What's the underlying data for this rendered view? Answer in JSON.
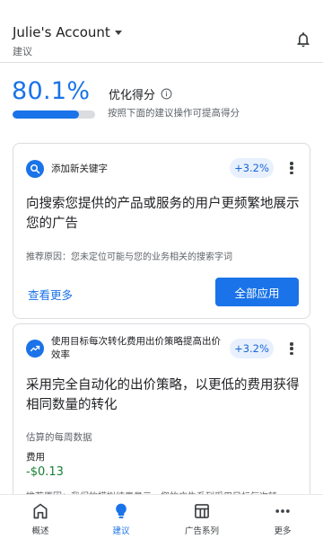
{
  "header": {
    "account_name": "Julie's Account",
    "section_title": "建议"
  },
  "score": {
    "value": "80.1%",
    "fraction": 0.801,
    "label": "优化得分",
    "description": "按照下面的建议操作可提高得分"
  },
  "cards": [
    {
      "title": "添加新关键字",
      "uplift": "+3.2%",
      "headline": "向搜索您提供的产品或服务的用户更频繁地展示您的广告",
      "reason": "推荐原因：您未定位可能与您的业务相关的搜索字词",
      "see_more": "查看更多",
      "apply_all": "全部应用"
    },
    {
      "title": "使用目标每次转化费用出价策略提高出价效率",
      "uplift": "+3.2%",
      "headline": "采用完全自动化的出价策略，以更低的费用获得相同数量的转化",
      "estimate_label": "估算的每周数据",
      "cost_label": "费用",
      "cost_value": "-$0.13",
      "reason_partial": "推荐原因：我们的模拟结果显示，您的广告系列采用目标每次转"
    }
  ],
  "nav": [
    {
      "label": "概述",
      "icon": "home-icon"
    },
    {
      "label": "建议",
      "icon": "lightbulb-icon"
    },
    {
      "label": "广告系列",
      "icon": "campaigns-icon"
    },
    {
      "label": "更多",
      "icon": "more-icon"
    }
  ],
  "colors": {
    "accent": "#1a73e8",
    "chip_bg": "#e8f0fe",
    "positive": "#188038"
  }
}
